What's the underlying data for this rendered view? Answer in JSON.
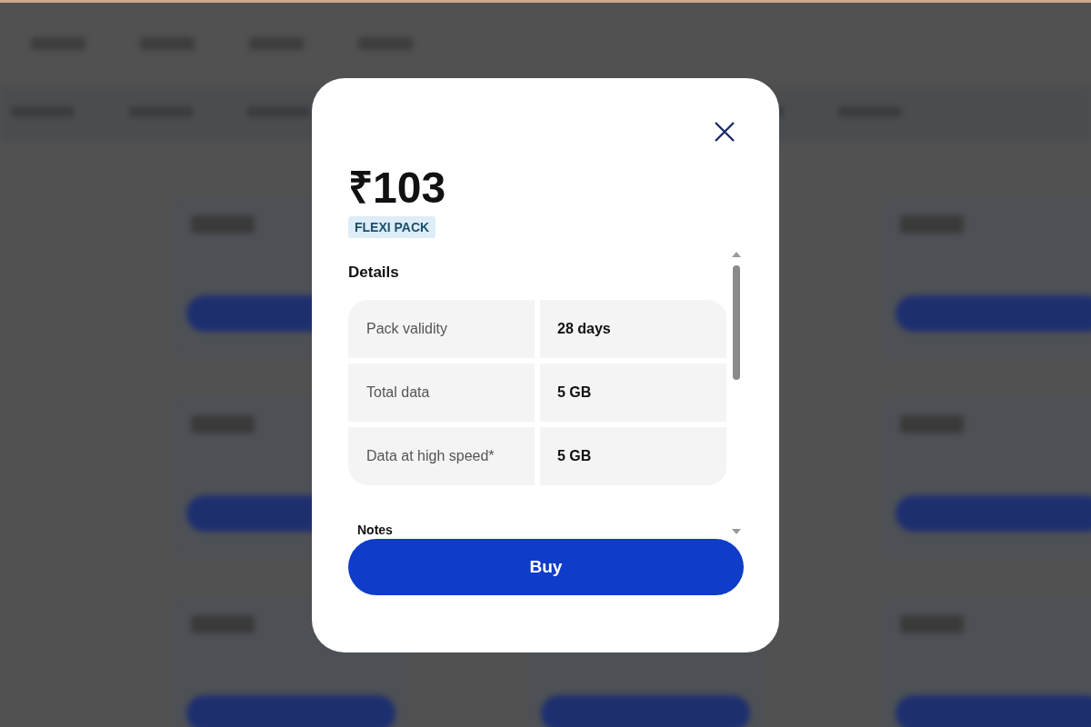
{
  "modal": {
    "price": "₹103",
    "badge": "FLEXI PACK",
    "section_title": "Details",
    "details": [
      {
        "label": "Pack validity",
        "value": "28 days"
      },
      {
        "label": "Total data",
        "value": "5 GB"
      },
      {
        "label": "Data at high speed*",
        "value": "5 GB"
      }
    ],
    "notes_title": "Notes",
    "button": "Buy"
  }
}
